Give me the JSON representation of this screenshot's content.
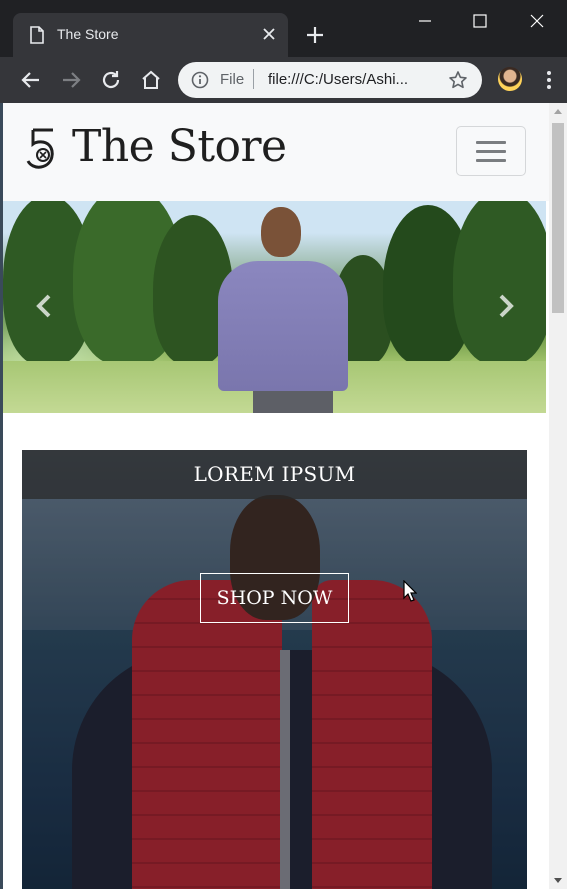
{
  "browser": {
    "tab": {
      "title": "The Store",
      "icon": "page-icon",
      "close_icon": "close-icon"
    },
    "new_tab_icon": "plus-icon",
    "window_controls": [
      "minimize-icon",
      "maximize-icon",
      "close-icon"
    ],
    "toolbar": {
      "back_icon": "arrow-left-icon",
      "forward_icon": "arrow-right-icon",
      "reload_icon": "reload-icon",
      "home_icon": "home-icon",
      "omnibox": {
        "scheme_label": "File",
        "url": "file:///C:/Users/Ashi...",
        "info_icon": "info-icon",
        "bookmark_icon": "star-icon"
      },
      "profile_icon": "avatar",
      "menu_icon": "kebab-menu-icon"
    }
  },
  "page": {
    "navbar": {
      "brand_name": "The Store",
      "logo_icon": "five-logo-icon",
      "toggle_icon": "hamburger-icon"
    },
    "carousel": {
      "prev_icon": "chevron-left-icon",
      "next_icon": "chevron-right-icon"
    },
    "promo": {
      "title": "LOREM IPSUM",
      "button_label": "SHOP NOW"
    }
  },
  "colors": {
    "chrome_dark": "#202124",
    "chrome_toolbar": "#35363a",
    "navbar_bg": "#f8f9fa",
    "promo_band": "#282828"
  }
}
